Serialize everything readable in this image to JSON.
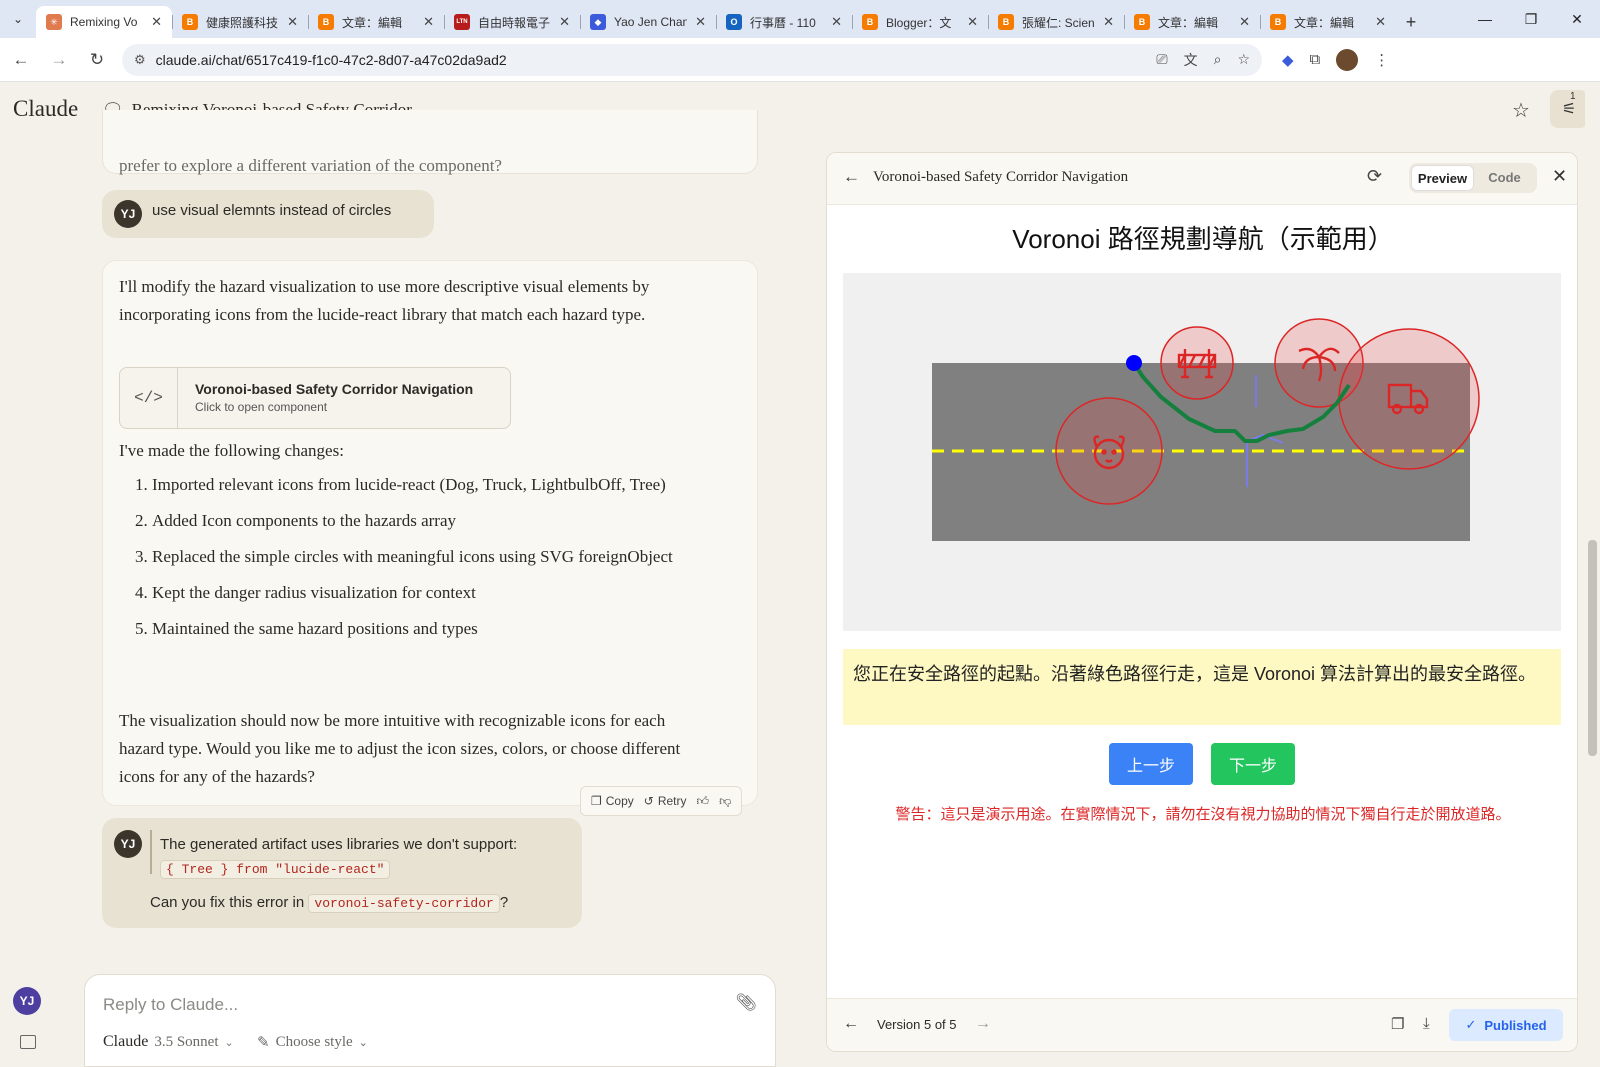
{
  "browser": {
    "tabs": [
      {
        "label": "Remixing Vo",
        "color": "#e07a4f",
        "glyph": "✳",
        "active": true
      },
      {
        "label": "健康照護科技",
        "color": "#f57c00",
        "glyph": "B"
      },
      {
        "label": "文章：編輯",
        "color": "#f57c00",
        "glyph": "B"
      },
      {
        "label": "自由時報電子",
        "color": "#b71c1c",
        "glyph": "LTN"
      },
      {
        "label": "Yao Jen Chan",
        "color": "#3b5bdb",
        "glyph": "◆"
      },
      {
        "label": "行事曆 - 110",
        "color": "#1565c0",
        "glyph": "O"
      },
      {
        "label": "Blogger：文",
        "color": "#f57c00",
        "glyph": "B"
      },
      {
        "label": "張耀仁: Scien",
        "color": "#f57c00",
        "glyph": "B"
      },
      {
        "label": "文章：編輯",
        "color": "#f57c00",
        "glyph": "B"
      },
      {
        "label": "文章：編輯",
        "color": "#f57c00",
        "glyph": "B"
      }
    ],
    "url": "claude.ai/chat/6517c419-f1c0-47c2-8d07-a47c02da9ad2"
  },
  "app": {
    "logo": "Claude",
    "conversation_title": "Remixing Voronoi-based Safety Corridor",
    "settings_badge": "1"
  },
  "chat": {
    "prev_tail": "prefer to explore a different variation of the component?",
    "user_message": {
      "initials": "YJ",
      "text": "use visual elemnts instead of circles"
    },
    "ai_message": {
      "intro": "I'll modify the hazard visualization to use more descriptive visual elements by incorporating icons from the lucide-react library that match each hazard type.",
      "artifact_title": "Voronoi-based Safety Corridor Navigation",
      "artifact_sub": "Click to open component",
      "changes_lead": "I've made the following changes:",
      "changes": [
        {
          "num": "1.",
          "text": "Imported relevant icons from lucide-react (Dog, Truck, LightbulbOff, Tree)"
        },
        {
          "num": "2.",
          "text": "Added Icon components to the hazards array"
        },
        {
          "num": "3.",
          "text": "Replaced the simple circles with meaningful icons using SVG foreignObject"
        },
        {
          "num": "4.",
          "text": "Kept the danger radius visualization for context"
        },
        {
          "num": "5.",
          "text": "Maintained the same hazard positions and types"
        }
      ],
      "outro": "The visualization should now be more intuitive with recognizable icons for each hazard type. Would you like me to adjust the icon sizes, colors, or choose different icons for any of the hazards?"
    },
    "actions": {
      "copy": "Copy",
      "retry": "Retry"
    },
    "error_message": {
      "initials": "YJ",
      "line1": "The generated artifact uses libraries we don't support:",
      "code": "{ Tree } from \"lucide-react\"",
      "line2_pre": "Can you fix this error in",
      "code2": "voronoi-safety-corridor",
      "line2_post": "?"
    },
    "sidebar_initials": "YJ"
  },
  "composer": {
    "placeholder": "Reply to Claude...",
    "model_name": "Claude",
    "model_version": "3.5 Sonnet",
    "style_label": "Choose style"
  },
  "artifact": {
    "header_title": "Voronoi-based Safety Corridor Navigation",
    "tab_preview": "Preview",
    "tab_code": "Code",
    "demo_title": "Voronoi 路徑規劃導航（示範用）",
    "info": "您正在安全路徑的起點。沿著綠色路徑行走，這是 Voronoi 算法計算出的最安全路徑。",
    "btn_prev": "上一步",
    "btn_next": "下一步",
    "warning": "警告：這只是演示用途。在實際情況下，請勿在沒有視力協助的情況下獨自行走於開放道路。",
    "version": "Version 5 of 5",
    "published": "Published",
    "colors": {
      "road": "#808080",
      "path": "#15803d",
      "hazard": "#dc2626",
      "start": "#0000ff",
      "lane": "#ffff00",
      "voronoi": "#7b7bff"
    }
  }
}
